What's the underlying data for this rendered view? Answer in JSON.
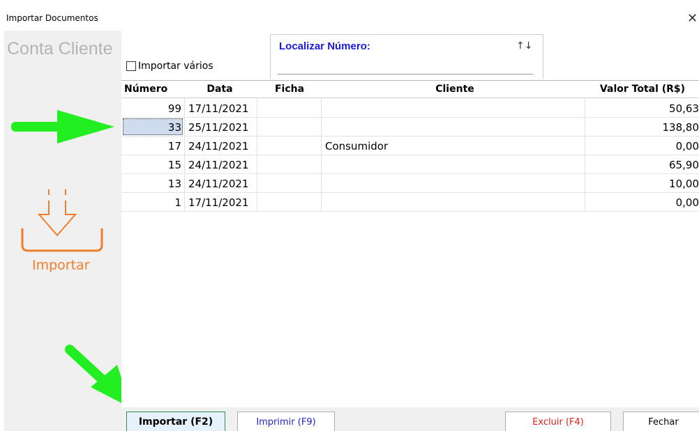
{
  "window": {
    "title": "Importar Documentos",
    "close_icon": "close-icon"
  },
  "left": {
    "heading": "Conta Cliente",
    "import_label": "Importar"
  },
  "options": {
    "importar_varios": "Importar vários"
  },
  "search": {
    "label": "Localizar Número:",
    "sort_icon": "↑↓",
    "value": ""
  },
  "table": {
    "columns": [
      "Número",
      "Data",
      "Ficha",
      "Cliente",
      "Valor Total (R$)"
    ],
    "rows": [
      {
        "numero": "99",
        "data": "17/11/2021",
        "ficha": "",
        "cliente": "",
        "valor": "50,63"
      },
      {
        "numero": "33",
        "data": "25/11/2021",
        "ficha": "",
        "cliente": "",
        "valor": "138,80"
      },
      {
        "numero": "17",
        "data": "24/11/2021",
        "ficha": "",
        "cliente": "Consumidor",
        "valor": "0,00"
      },
      {
        "numero": "15",
        "data": "24/11/2021",
        "ficha": "",
        "cliente": "",
        "valor": "65,90"
      },
      {
        "numero": "13",
        "data": "24/11/2021",
        "ficha": "",
        "cliente": "",
        "valor": "10,00"
      },
      {
        "numero": "1",
        "data": "17/11/2021",
        "ficha": "",
        "cliente": "",
        "valor": "0,00"
      }
    ],
    "selected_row": 1
  },
  "buttons": {
    "importar": "Importar (F2)",
    "imprimir": "Imprimir (F9)",
    "excluir": "Excluir (F4)",
    "fechar": "Fechar"
  },
  "colors": {
    "accent_orange": "#f07d2a",
    "annotation_green": "#22ee22",
    "search_label_blue": "#1a1ae0",
    "delete_red": "#e02020"
  }
}
